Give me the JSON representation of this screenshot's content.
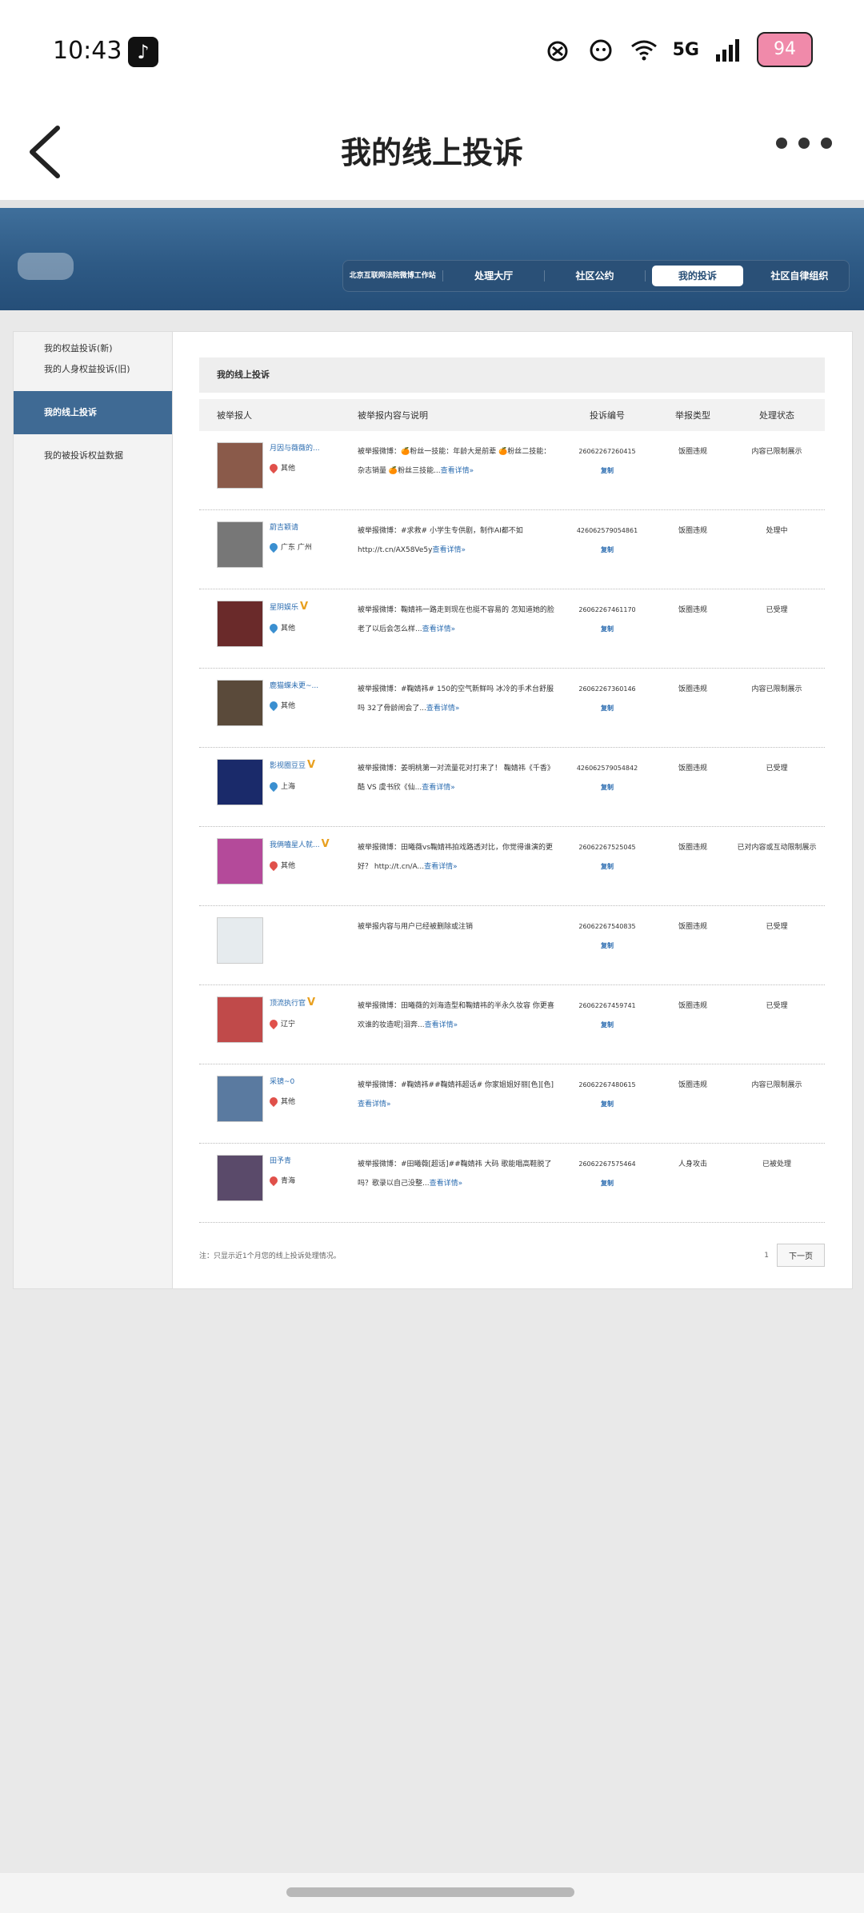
{
  "status": {
    "time": "10:43",
    "network": "5G",
    "battery": "94"
  },
  "titlebar": {
    "title": "我的线上投诉"
  },
  "nav": {
    "items": [
      {
        "label": "北京互联网法院微博工作站",
        "active": false
      },
      {
        "label": "处理大厅",
        "active": false
      },
      {
        "label": "社区公约",
        "active": false
      },
      {
        "label": "我的投诉",
        "active": true
      },
      {
        "label": "社区自律组织",
        "active": false
      }
    ]
  },
  "sidebar": {
    "items": [
      {
        "label": "我的权益投诉(新)"
      },
      {
        "label": "我的人身权益投诉(旧)"
      },
      {
        "label": "我的线上投诉"
      },
      {
        "label": "我的被投诉权益数据"
      }
    ]
  },
  "section": {
    "title": "我的线上投诉"
  },
  "table": {
    "headers": [
      "被举报人",
      "被举报内容与说明",
      "投诉编号",
      "举报类型",
      "处理状态"
    ],
    "rows": [
      {
        "name": "月因与薇薇的...",
        "verified": false,
        "location": "其他",
        "loc_color": "#e0504a",
        "content": "被举报微博：🍊粉丝一技能：年龄大是前辈 🍊粉丝二技能：杂志销量 🍊粉丝三技能...",
        "more": "查看详情»",
        "id": "26062267260415",
        "copy": "复制",
        "type": "饭圈违规",
        "status": "内容已限制展示",
        "avatar": "#8a5a4a"
      },
      {
        "name": "蔚吉颖请",
        "verified": false,
        "location": "广东 广州",
        "loc_color": "#3a8fd0",
        "content": "被举报微博：#求救# 小学生专供剧，制作AI都不如 http://t.cn/AX58Ve5y",
        "more": "查看详情»",
        "id": "426062579054861",
        "copy": "复制",
        "type": "饭圈违规",
        "status": "处理中",
        "avatar": "#777"
      },
      {
        "name": "星阴娱乐",
        "verified": true,
        "location": "其他",
        "loc_color": "#3a8fd0",
        "content": "被举报微博：鞠婧祎一路走到现在也挺不容易的 怎知道她的脸老了以后会怎么样...",
        "more": "查看详情»",
        "id": "26062267461170",
        "copy": "复制",
        "type": "饭圈违规",
        "status": "已受理",
        "avatar": "#6a2a2a"
      },
      {
        "name": "鹿猫蝶未更~...",
        "verified": false,
        "location": "其他",
        "loc_color": "#3a8fd0",
        "content": "被举报微博：#鞠婧祎# 150的空气新鲜吗 冰冷的手术台舒服吗 32了骨龄闹会了...",
        "more": "查看详情»",
        "id": "26062267360146",
        "copy": "复制",
        "type": "饭圈违规",
        "status": "内容已限制展示",
        "avatar": "#5a4a3a"
      },
      {
        "name": "影视圈豆豆",
        "verified": true,
        "location": "上海",
        "loc_color": "#3a8fd0",
        "content": "被举报微博：姜明桃第一对流量花对打来了！ 鞠婧祎《千香》酷 VS 虞书欣《仙...",
        "more": "查看详情»",
        "id": "426062579054842",
        "copy": "复制",
        "type": "饭圈违规",
        "status": "已受理",
        "avatar": "#1a2a6a"
      },
      {
        "name": "我俩嗑星人就...",
        "verified": true,
        "location": "其他",
        "loc_color": "#e0504a",
        "content": "被举报微博：田曦薇vs鞠婧祎拍戏路透对比，你觉得谁演的更好？ http://t.cn/A...",
        "more": "查看详情»",
        "id": "26062267525045",
        "copy": "复制",
        "type": "饭圈违规",
        "status": "已对内容或互动限制展示",
        "avatar": "#b44a9a"
      },
      {
        "name": "",
        "verified": false,
        "location": "",
        "loc_color": "",
        "content": "被举报内容与用户已经被删除或注销",
        "more": "",
        "id": "26062267540835",
        "copy": "复制",
        "type": "饭圈违规",
        "status": "已受理",
        "avatar": "#e6ebee"
      },
      {
        "name": "顶流执行官",
        "verified": true,
        "location": "辽宁",
        "loc_color": "#e0504a",
        "content": "被举报微博：田曦薇的刘海造型和鞠婧祎的半永久妆容 你更喜欢谁的妆造呢|泪奔...",
        "more": "查看详情»",
        "id": "26062267459741",
        "copy": "复制",
        "type": "饭圈违规",
        "status": "已受理",
        "avatar": "#c04a4a"
      },
      {
        "name": "采镜~0",
        "verified": false,
        "location": "其他",
        "loc_color": "#e0504a",
        "content": "被举报微博：#鞠婧祎##鞠婧祎超话# 你家姐姐好丽[色][色]",
        "more": "查看详情»",
        "id": "26062267480615",
        "copy": "复制",
        "type": "饭圈违规",
        "status": "内容已限制展示",
        "avatar": "#5a7aa0"
      },
      {
        "name": "田予青",
        "verified": false,
        "location": "青海",
        "loc_color": "#e0504a",
        "content": "被举报微博：#田曦薇[超话]##鞠婧祎 大码 歌能唱高鞋脱了吗？歌录以自己没整...",
        "more": "查看详情»",
        "id": "26062267575464",
        "copy": "复制",
        "type": "人身攻击",
        "status": "已被处理",
        "avatar": "#5a4a6a"
      }
    ]
  },
  "footer": {
    "note": "注：只显示近1个月您的线上投诉处理情况。",
    "page": "1",
    "next": "下一页"
  }
}
